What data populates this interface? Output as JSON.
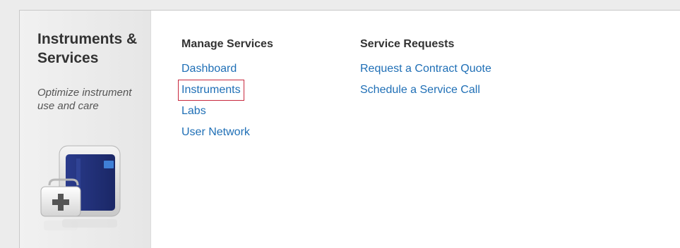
{
  "sidebar": {
    "title": "Instruments & Services",
    "subtitle": "Optimize instrument use and care",
    "icon": "instrument-with-medical-kit-icon"
  },
  "manage_services": {
    "heading": "Manage Services",
    "links": [
      {
        "label": "Dashboard"
      },
      {
        "label": "Instruments",
        "highlighted": true
      },
      {
        "label": "Labs"
      },
      {
        "label": "User Network"
      }
    ]
  },
  "service_requests": {
    "heading": "Service Requests",
    "links": [
      {
        "label": "Request a Contract Quote"
      },
      {
        "label": "Schedule a Service Call"
      }
    ]
  },
  "colors": {
    "link": "#1f6fb6",
    "heading": "#333333",
    "highlight_border": "#c8283e",
    "sidebar_bg": "#ececec"
  }
}
